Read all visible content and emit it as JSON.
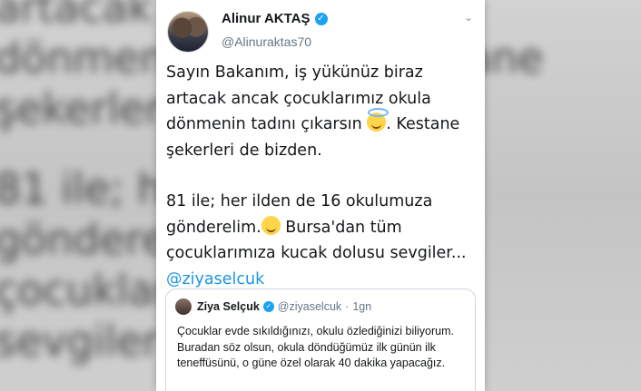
{
  "background": {
    "blur_line1": "artacak a           okula\ndönmenin           . Kestane\nşekerleri d",
    "blur_line2": "81 ile; her          muza\ngönderelin          tüm\nçocuklarım         su\nsevgiler"
  },
  "tweet": {
    "author_name": "Alinur AKTAŞ",
    "author_handle": "@Alinuraktas70",
    "paragraph1_part1": "Sayın Bakanım, iş yükünüz biraz artacak ancak çocuklarımız okula dönmenin tadını çıkarsın ",
    "paragraph1_part2": ". Kestane şekerleri de bizden.",
    "paragraph2_part1": "81 ile; her ilden de 16 okulumuza gönderelim.",
    "paragraph2_part2": " Bursa'dan tüm çocuklarımıza kucak dolusu sevgiler... ",
    "mention": "@ziyaselcuk",
    "emoji1": "smiling-face-with-halo",
    "emoji2": "smiling-face"
  },
  "quoted_tweet": {
    "author_name": "Ziya Selçuk",
    "author_handle": "@ziyaselcuk",
    "separator": "·",
    "time": "1gn",
    "text": "Çocuklar evde sıkıldığınızı, okulu özlediğinizi biliyorum. Buradan söz olsun, okula döndüğümüz ilk günün ilk teneffüsünü, o güne özel olarak 40 dakika yapacağız."
  },
  "colors": {
    "link": "#1b95e0",
    "verified": "#1da1f2",
    "secondary_text": "#657786"
  }
}
